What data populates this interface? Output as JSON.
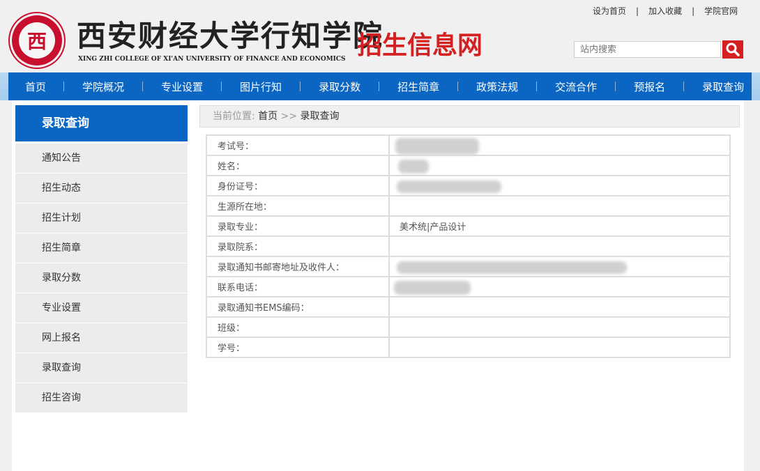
{
  "header": {
    "logo_seal_char": "西",
    "school_name_calligraphy": "西安财经大学行知学院",
    "school_name_en": "XING ZHI COLLEGE OF XI'AN UNIVERSITY OF FINANCE AND ECONOMICS",
    "site_name": "招生信息网",
    "top_links": [
      "设为首页",
      "加入收藏",
      "学院官网"
    ],
    "top_link_sep": "|",
    "search_placeholder": "站内搜索",
    "brand_red": "#d42020"
  },
  "nav": {
    "items": [
      "首页",
      "学院概况",
      "专业设置",
      "图片行知",
      "录取分数",
      "招生简章",
      "政策法规",
      "交流合作",
      "预报名",
      "录取查询"
    ],
    "bg_color": "#0a66c2"
  },
  "sidebar": {
    "title": "录取查询",
    "items": [
      "通知公告",
      "招生动态",
      "招生计划",
      "招生简章",
      "录取分数",
      "专业设置",
      "网上报名",
      "录取查询",
      "招生咨询"
    ]
  },
  "breadcrumb": {
    "prefix": "当前位置:",
    "home": "首页",
    "sep": ">>",
    "current": "录取查询"
  },
  "result": {
    "rows": [
      {
        "label": "考试号：",
        "value": ""
      },
      {
        "label": "姓名：",
        "value": ""
      },
      {
        "label": "身份证号：",
        "value": ""
      },
      {
        "label": "生源所在地：",
        "value": ""
      },
      {
        "label": "录取专业：",
        "value": "美术统|产品设计"
      },
      {
        "label": "录取院系：",
        "value": ""
      },
      {
        "label": "录取通知书邮寄地址及收件人：",
        "value": ""
      },
      {
        "label": "联系电话：",
        "value": ""
      },
      {
        "label": "录取通知书EMS编码：",
        "value": ""
      },
      {
        "label": "班级：",
        "value": ""
      },
      {
        "label": "学号：",
        "value": ""
      }
    ]
  }
}
